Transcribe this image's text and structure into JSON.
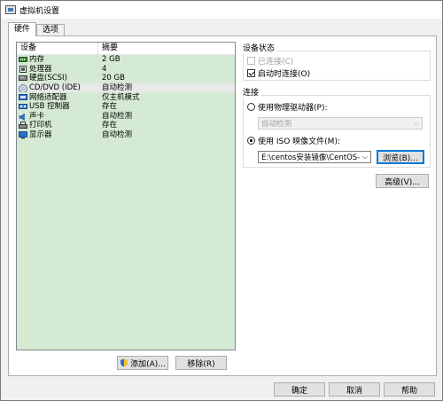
{
  "window": {
    "title": "虚拟机设置"
  },
  "tabs": [
    {
      "label": "硬件",
      "active": true
    },
    {
      "label": "选项",
      "active": false
    }
  ],
  "device_list": {
    "headers": {
      "device": "设备",
      "summary": "摘要"
    },
    "rows": [
      {
        "device": "内存",
        "summary": "2 GB",
        "icon": "memory-icon",
        "selected": false
      },
      {
        "device": "处理器",
        "summary": "4",
        "icon": "processor-icon",
        "selected": false
      },
      {
        "device": "硬盘(SCSI)",
        "summary": "20 GB",
        "icon": "hard-disk-icon",
        "selected": false
      },
      {
        "device": "CD/DVD (IDE)",
        "summary": "自动检测",
        "icon": "cd-dvd-icon",
        "selected": true
      },
      {
        "device": "网络适配器",
        "summary": "仅主机模式",
        "icon": "network-adapter-icon",
        "selected": false
      },
      {
        "device": "USB 控制器",
        "summary": "存在",
        "icon": "usb-icon",
        "selected": false
      },
      {
        "device": "声卡",
        "summary": "自动检测",
        "icon": "sound-card-icon",
        "selected": false
      },
      {
        "device": "打印机",
        "summary": "存在",
        "icon": "printer-icon",
        "selected": false
      },
      {
        "device": "显示器",
        "summary": "自动检测",
        "icon": "display-icon",
        "selected": false
      }
    ],
    "bg_color": "#d5ead2"
  },
  "buttons": {
    "add": "添加(A)...",
    "remove": "移除(R)",
    "browse": "浏览(B)...",
    "advanced": "高级(V)...",
    "ok": "确定",
    "cancel": "取消",
    "help": "帮助"
  },
  "device_status": {
    "title": "设备状态",
    "connected_label": "已连接(C)",
    "connected": false,
    "connect_at_power_on_label": "启动时连接(O)",
    "connect_at_power_on": true
  },
  "connection": {
    "title": "连接",
    "physical_drive_label": "使用物理驱动器(P):",
    "physical_drive_selected": false,
    "physical_drive_value": "自动检测",
    "iso_label": "使用 ISO 映像文件(M):",
    "iso_selected": true,
    "iso_path": "E:\\centos安装镜像\\CentOS-"
  },
  "colors": {
    "accent": "#0078d7"
  }
}
